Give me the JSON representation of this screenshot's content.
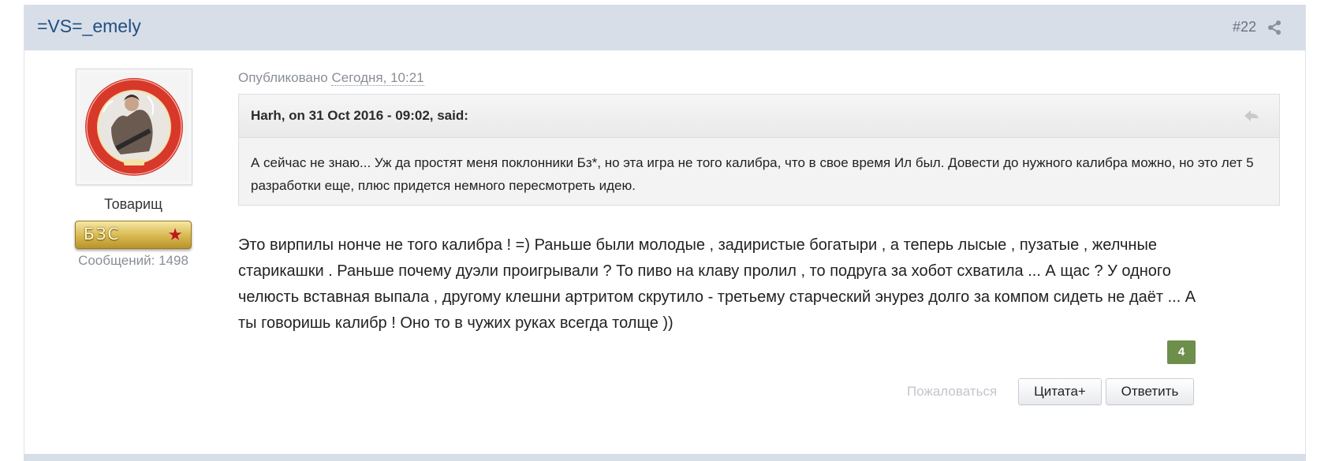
{
  "post": {
    "author": "=VS=_emely",
    "number": "#22",
    "published_label": "Опубликовано",
    "published_date": "Сегодня, 10:21",
    "member_title": "Товарищ",
    "rank_badge_text": "БЗС",
    "post_count": "Сообщений: 1498",
    "quote": {
      "citation": "Harh, on 31 Oct 2016 - 09:02, said:",
      "text": "А сейчас не знаю... Уж да простят меня поклонники Бз*, но эта игра не того калибра, что в свое время Ил был. Довести до нужного калибра можно, но это лет 5 разработки еще, плюс придется немного пересмотреть идею."
    },
    "body": "Это вирпилы нонче не того калибра ! =) Раньше были молодые , задиристые богатыри , а теперь лысые , пузатые , желчные старикашки . Раньше почему дуэли проигрывали ? То пиво на клаву пролил , то подруга за хобот схватила ... А щас ? У одного челюсть вставная выпала , другому клешни артритом скрутило - третьему старческий энурез долго за компом сидеть не даёт ... А ты говоришь калибр ! Оно то в чужих руках всегда толще ))",
    "reputation": "4",
    "report_label": "Пожаловаться",
    "quote_button_label": "Цитата+",
    "reply_button_label": "Ответить"
  },
  "icons": {
    "share": "share-icon",
    "quote_toggle": "quote-arrow-icon",
    "rank_star": "star-icon"
  },
  "colors": {
    "header_bg": "#d8dee8",
    "author_link": "#1f4f82",
    "reputation_bg": "#6e8f4c"
  }
}
